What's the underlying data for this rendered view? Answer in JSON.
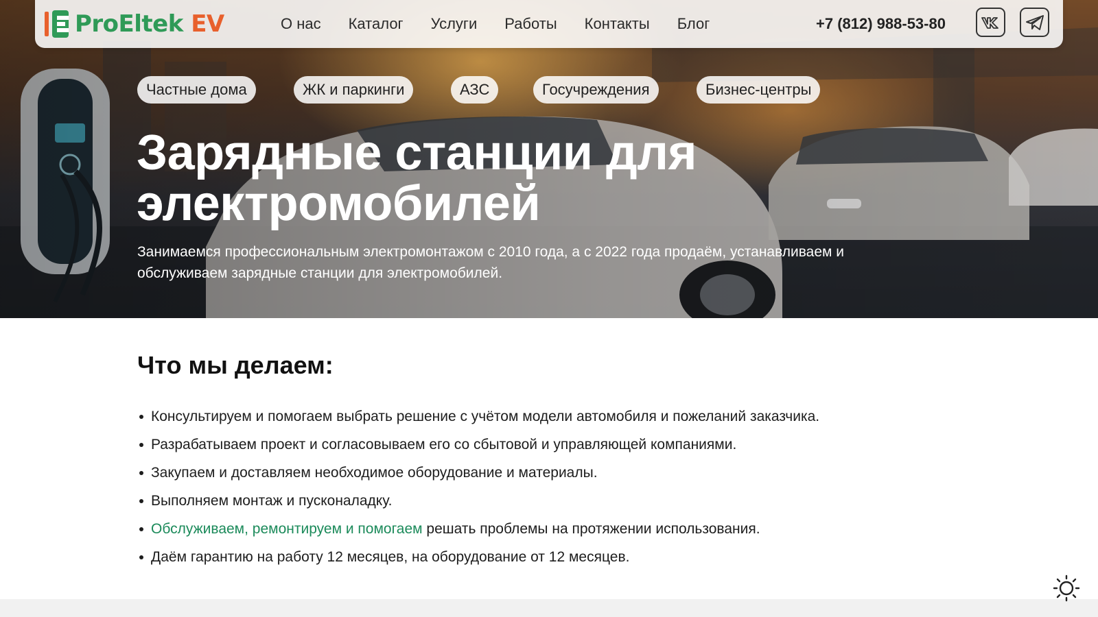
{
  "header": {
    "logo": {
      "part1": "Pro",
      "part2": "Eltek",
      "part3": " EV"
    },
    "nav": [
      "О нас",
      "Каталог",
      "Услуги",
      "Работы",
      "Контакты",
      "Блог"
    ],
    "phone": "+7 (812) 988-53-80",
    "social": [
      {
        "icon": "vk-icon"
      },
      {
        "icon": "telegram-icon"
      }
    ]
  },
  "hero": {
    "chips": [
      "Частные дома",
      "ЖК и паркинги",
      "АЗС",
      "Госучреждения",
      "Бизнес-центры"
    ],
    "title_line1": "Зарядные станции для",
    "title_line2": "электромобилей",
    "subtitle": "Занимаемся профессиональным электромонтажом с 2010 года, а с 2022 года продаём, устанавливаем и обслуживаем зарядные станции для электромобилей."
  },
  "content": {
    "title": "Что мы делаем:",
    "items": [
      {
        "text": "Консультируем и помогаем выбрать решение с учётом модели автомобиля и пожеланий заказчика."
      },
      {
        "text": "Разрабатываем проект и согласовываем его со сбытовой и управляющей компаниями."
      },
      {
        "text": "Закупаем и доставляем необходимое оборудование и материалы."
      },
      {
        "text": "Выполняем монтаж и пусконаладку."
      },
      {
        "link": "Обслуживаем, ремонтируем и помогаем",
        "text": " решать проблемы на протяжении использования."
      },
      {
        "text": "Даём гарантию на работу 12 месяцев, на оборудование от 12 месяцев."
      }
    ]
  },
  "colors": {
    "accent_green": "#2f9a57",
    "link_green": "#1b8a5a",
    "accent_orange": "#e8602c"
  },
  "icons": {
    "theme_toggle": "sun-icon"
  }
}
